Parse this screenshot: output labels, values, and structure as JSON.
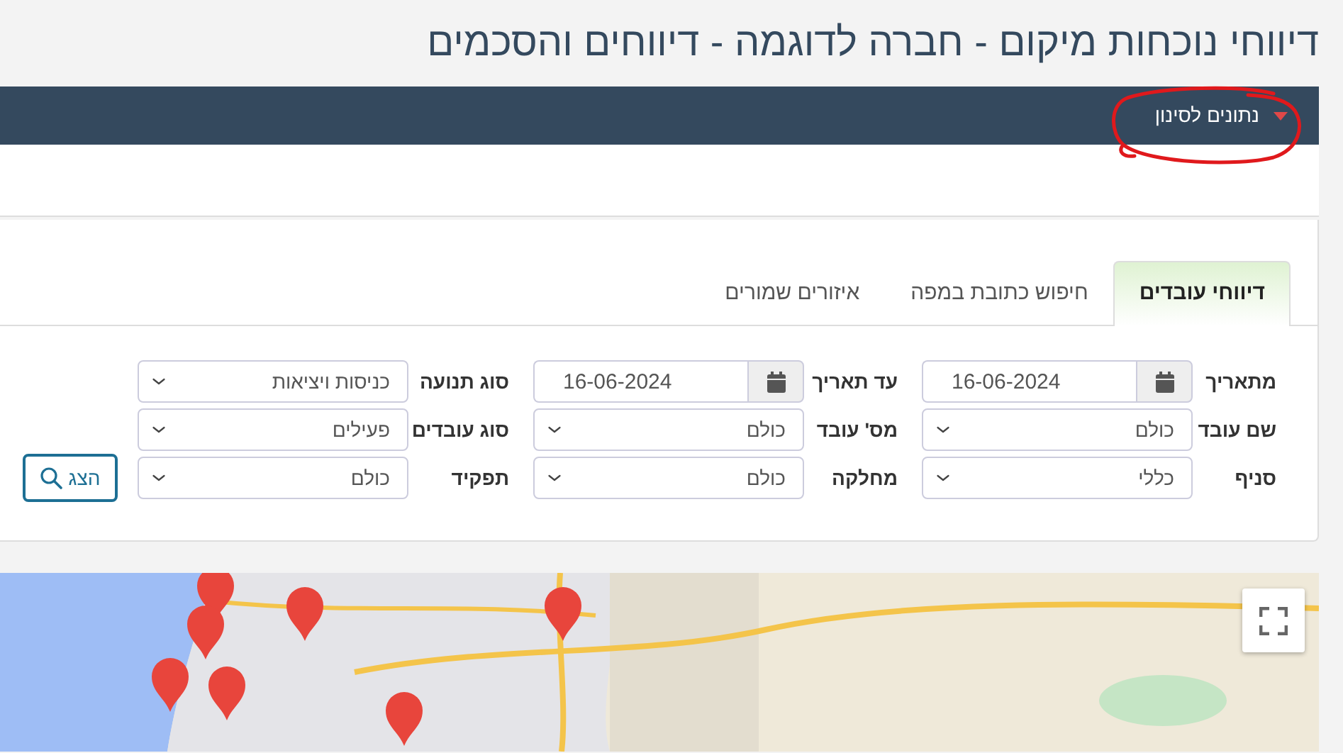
{
  "page_title": "דיווחי נוכחות מיקום - חברה לדוגמה - דיווחים והסכמים",
  "filter_toggle": {
    "label": "נתונים לסינון"
  },
  "annotation": {
    "kind": "freehand-circle"
  },
  "tabs": [
    {
      "label": "דיווחי עובדים",
      "selected": true
    },
    {
      "label": "חיפוש כתובת במפה",
      "selected": false
    },
    {
      "label": "איזורים שמורים",
      "selected": false
    }
  ],
  "form": {
    "fields": [
      {
        "kind": "date",
        "label": "מתאריך",
        "value": "16-06-2024"
      },
      {
        "kind": "date",
        "label": "עד תאריך",
        "value": "16-06-2024"
      },
      {
        "kind": "select",
        "label": "סוג תנועה",
        "value": "כניסות ויציאות"
      },
      {
        "kind": "select",
        "label": "שם עובד",
        "value": "כולם"
      },
      {
        "kind": "select",
        "label": "מס' עובד",
        "value": "כולם"
      },
      {
        "kind": "select",
        "label": "סוג עובדים",
        "value": "פעילים"
      },
      {
        "kind": "select",
        "label": "סניף",
        "value": "כללי"
      },
      {
        "kind": "select",
        "label": "מחלקה",
        "value": "כולם"
      },
      {
        "kind": "select",
        "label": "תפקיד",
        "value": "כולם"
      }
    ],
    "search_button": {
      "label": "הצג"
    }
  }
}
